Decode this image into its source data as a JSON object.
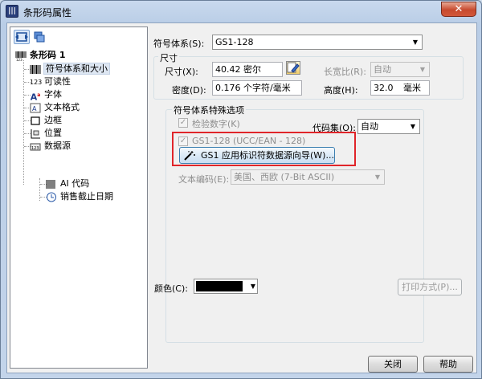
{
  "window": {
    "title": "条形码属性",
    "close": "✕"
  },
  "tree": {
    "items": [
      {
        "label": "条形码 1"
      },
      {
        "label": "符号体系和大小"
      },
      {
        "label": "可读性"
      },
      {
        "label": "字体"
      },
      {
        "label": "文本格式"
      },
      {
        "label": "边框"
      },
      {
        "label": "位置"
      },
      {
        "label": "数据源"
      },
      {
        "label": "AI 代码"
      },
      {
        "label": "销售截止日期"
      }
    ]
  },
  "symbology": {
    "label": "符号体系(S):",
    "value": "GS1-128"
  },
  "size": {
    "group_title": "尺寸",
    "size_label": "尺寸(X):",
    "size_value": "40.42 密尔",
    "ratio_label": "长宽比(R):",
    "ratio_value": "自动",
    "density_label": "密度(D):",
    "density_value": "0.176 个字符/毫米",
    "height_label": "高度(H):",
    "height_value": "32.0",
    "height_unit": "毫米"
  },
  "options": {
    "group_title": "符号体系特殊选项",
    "check_digit_label": "检验数字(K)",
    "check_digit_checked": true,
    "codeset_label": "代码集(O):",
    "codeset_value": "自动",
    "gs1_label": "GS1-128 (UCC/EAN - 128)",
    "gs1_checked": true,
    "wizard_button": "GS1 应用标识符数据源向导(W)...",
    "encoding_label": "文本编码(E):",
    "encoding_value": "美国、西欧 (7-Bit ASCII)"
  },
  "color": {
    "label": "颜色(C):",
    "value_hex": "#000000"
  },
  "print_mode_button": "打印方式(P)...",
  "footer": {
    "close_button": "关闭",
    "help_button": "帮助"
  }
}
